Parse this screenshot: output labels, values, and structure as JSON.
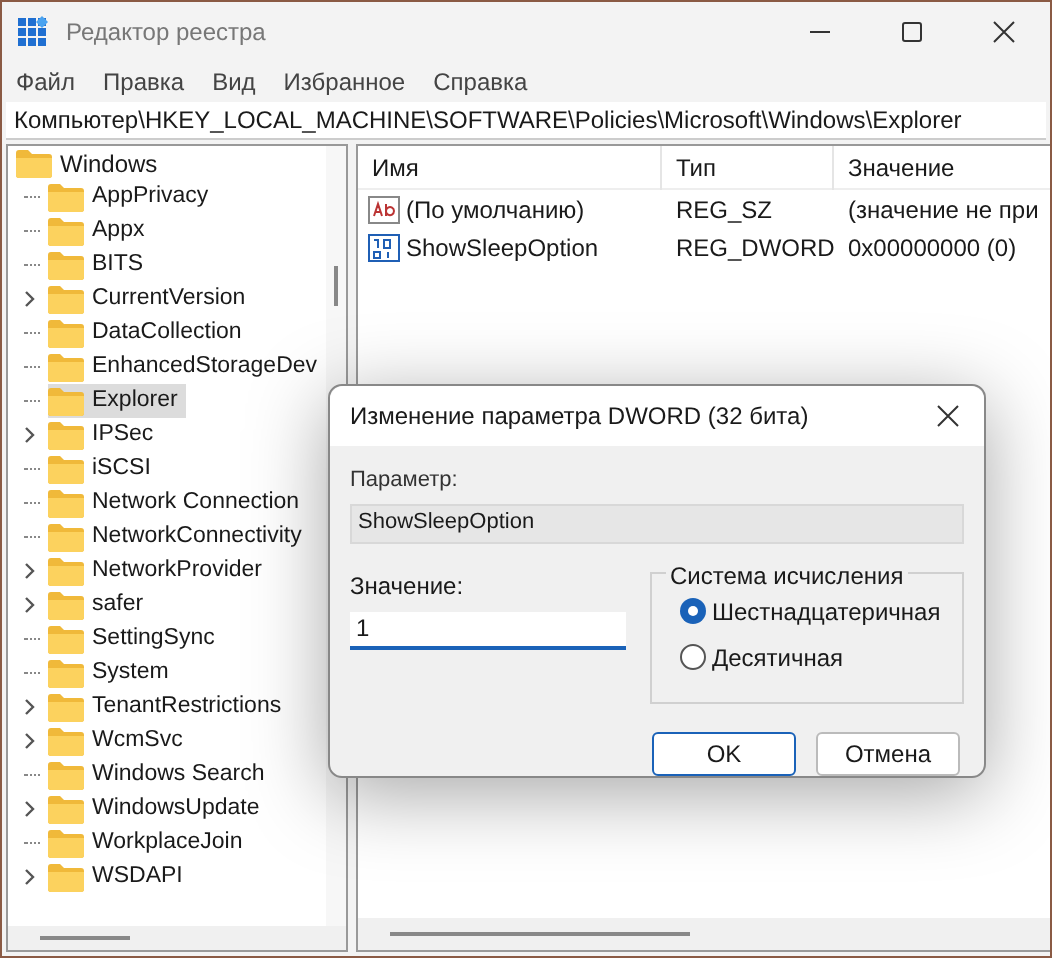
{
  "window": {
    "title": "Редактор реестра"
  },
  "menu": [
    "Файл",
    "Правка",
    "Вид",
    "Избранное",
    "Справка"
  ],
  "address": "Компьютер\\HKEY_LOCAL_MACHINE\\SOFTWARE\\Policies\\Microsoft\\Windows\\Explorer",
  "tree": [
    {
      "label": "Windows",
      "expanded": true,
      "selected": false,
      "children": [
        {
          "label": "AppPrivacy",
          "expandable": false,
          "selected": false
        },
        {
          "label": "Appx",
          "expandable": false,
          "selected": false
        },
        {
          "label": "BITS",
          "expandable": false,
          "selected": false
        },
        {
          "label": "CurrentVersion",
          "expandable": true,
          "selected": false
        },
        {
          "label": "DataCollection",
          "expandable": false,
          "selected": false
        },
        {
          "label": "EnhancedStorageDev",
          "expandable": false,
          "selected": false
        },
        {
          "label": "Explorer",
          "expandable": false,
          "selected": true
        },
        {
          "label": "IPSec",
          "expandable": true,
          "selected": false
        },
        {
          "label": "iSCSI",
          "expandable": false,
          "selected": false
        },
        {
          "label": "Network Connection",
          "expandable": false,
          "selected": false
        },
        {
          "label": "NetworkConnectivity",
          "expandable": false,
          "selected": false
        },
        {
          "label": "NetworkProvider",
          "expandable": true,
          "selected": false
        },
        {
          "label": "safer",
          "expandable": true,
          "selected": false
        },
        {
          "label": "SettingSync",
          "expandable": false,
          "selected": false
        },
        {
          "label": "System",
          "expandable": false,
          "selected": false
        },
        {
          "label": "TenantRestrictions",
          "expandable": true,
          "selected": false
        },
        {
          "label": "WcmSvc",
          "expandable": true,
          "selected": false
        },
        {
          "label": "Windows Search",
          "expandable": false,
          "selected": false
        },
        {
          "label": "WindowsUpdate",
          "expandable": true,
          "selected": false
        },
        {
          "label": "WorkplaceJoin",
          "expandable": false,
          "selected": false
        },
        {
          "label": "WSDAPI",
          "expandable": true,
          "selected": false
        }
      ]
    }
  ],
  "table": {
    "columns": [
      "Имя",
      "Тип",
      "Значение"
    ],
    "rows": [
      {
        "kind": "string",
        "name": "(По умолчанию)",
        "type": "REG_SZ",
        "value": "(значение не при"
      },
      {
        "kind": "dword",
        "name": "ShowSleepOption",
        "type": "REG_DWORD",
        "value": "0x00000000 (0)"
      }
    ]
  },
  "dialog": {
    "title": "Изменение параметра DWORD (32 бита)",
    "name_label": "Параметр:",
    "name_value": "ShowSleepOption",
    "value_label": "Значение:",
    "value": "1",
    "base_group": "Система исчисления",
    "bases": [
      {
        "label": "Шестнадцатеричная",
        "selected": true
      },
      {
        "label": "Десятичная",
        "selected": false
      }
    ],
    "buttons": [
      {
        "label": "OK",
        "default": true
      },
      {
        "label": "Отмена",
        "default": false
      }
    ]
  }
}
